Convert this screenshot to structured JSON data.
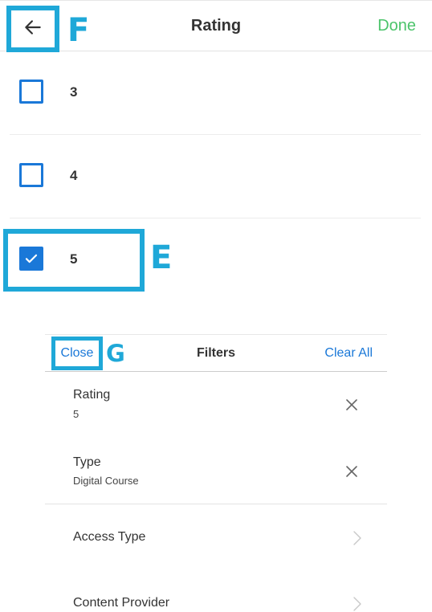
{
  "annotations": {
    "f": "F",
    "e": "E",
    "g": "G"
  },
  "rating_screen": {
    "title": "Rating",
    "done_label": "Done",
    "options": [
      {
        "label": "3",
        "checked": false
      },
      {
        "label": "4",
        "checked": false
      },
      {
        "label": "5",
        "checked": true
      }
    ]
  },
  "filters_panel": {
    "close_label": "Close",
    "title": "Filters",
    "clear_all_label": "Clear All",
    "applied": [
      {
        "name": "Rating",
        "value": "5"
      },
      {
        "name": "Type",
        "value": "Digital Course"
      }
    ],
    "categories": [
      {
        "name": "Access Type"
      },
      {
        "name": "Content Provider"
      }
    ]
  },
  "colors": {
    "accent_blue": "#1a78d8",
    "annotation_cyan": "#1fa8d8",
    "done_green": "#4cc46b"
  },
  "icons": [
    "back-arrow-icon",
    "checkmark-icon",
    "close-x-icon",
    "chevron-right-icon"
  ]
}
